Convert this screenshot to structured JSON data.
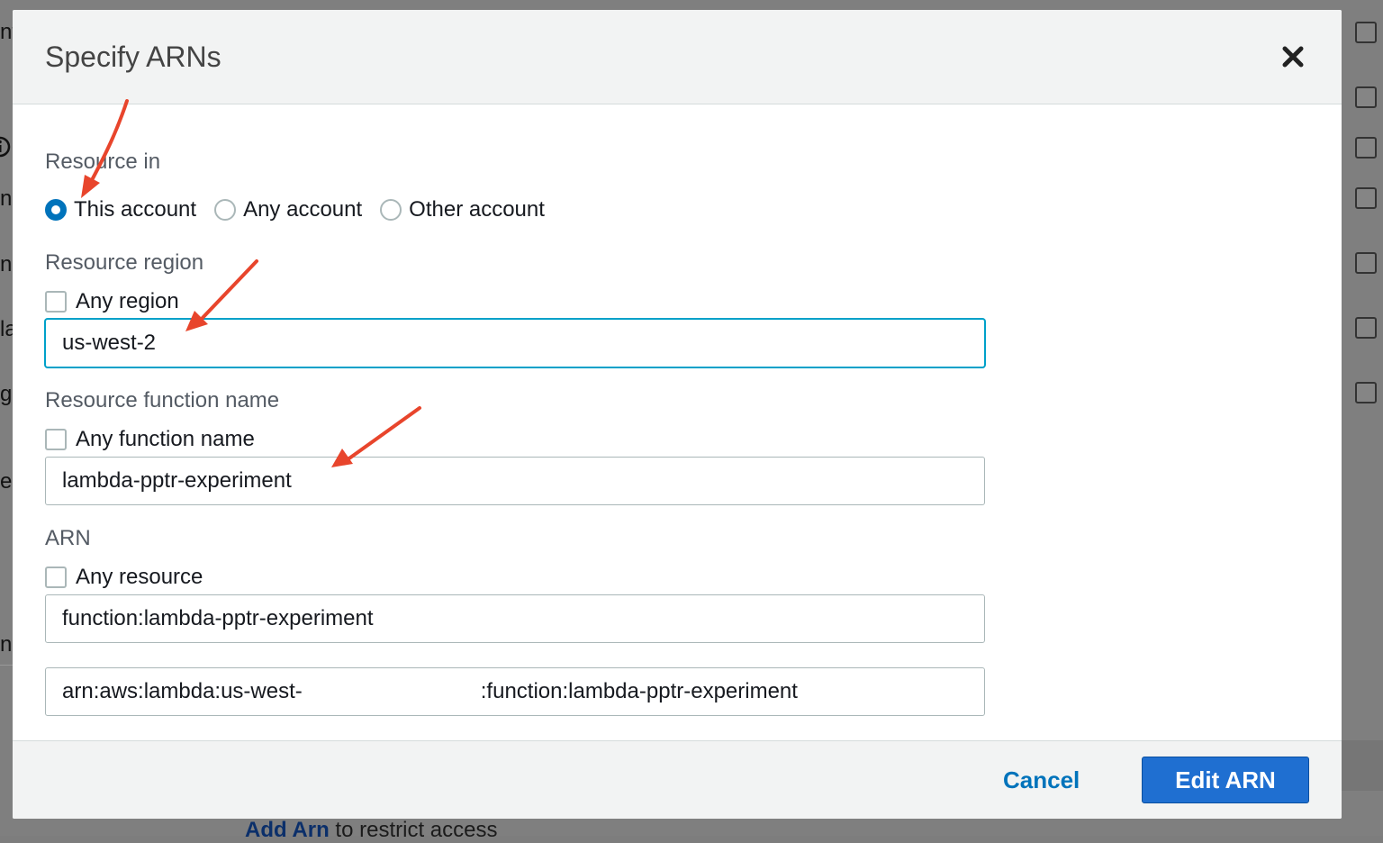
{
  "background": {
    "fragments": [
      "nf",
      "n",
      "ne",
      "la",
      "g",
      "e",
      "ne"
    ],
    "bottom_link": "Add Arn",
    "bottom_text": " to restrict access"
  },
  "modal": {
    "title": "Specify ARNs",
    "resource_in": {
      "label": "Resource in",
      "options": [
        "This account",
        "Any account",
        "Other account"
      ],
      "selected": "This account"
    },
    "resource_region": {
      "label": "Resource region",
      "any_label": "Any region",
      "any_checked": false,
      "value": "us-west-2"
    },
    "resource_function_name": {
      "label": "Resource function name",
      "any_label": "Any function name",
      "any_checked": false,
      "value": "lambda-pptr-experiment"
    },
    "arn": {
      "label": "ARN",
      "any_label": "Any resource",
      "any_checked": false,
      "resource_value": "function:lambda-pptr-experiment",
      "full_arn_prefix": "arn:aws:lambda:us-west-",
      "full_arn_suffix": ":function:lambda-pptr-experiment"
    },
    "footer": {
      "cancel_label": "Cancel",
      "primary_label": "Edit ARN"
    }
  },
  "colors": {
    "accent": "#0073bb",
    "primary_button": "#1f6fd1",
    "annotation_arrow": "#e8452c",
    "overlay": "#7f7f7f"
  },
  "icons": {
    "close": "close-icon"
  }
}
